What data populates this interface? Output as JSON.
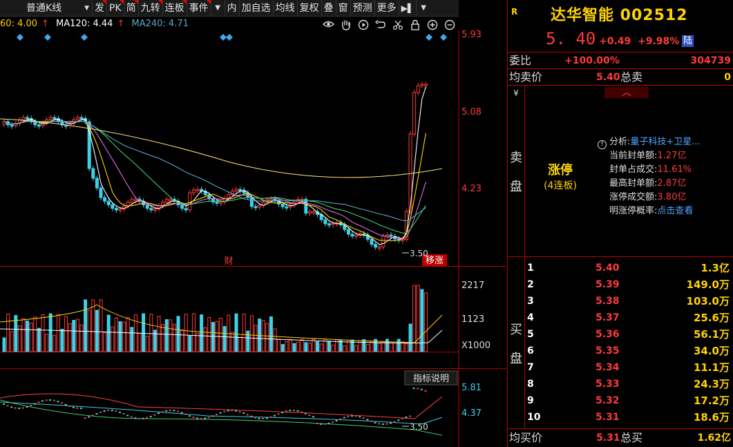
{
  "toolbar": {
    "kline_label": "普通K线",
    "buttons": [
      "发",
      "PK",
      "简",
      "九转",
      "连板",
      "事件",
      "内",
      "加自选",
      "均线",
      "复权",
      "叠",
      "窗",
      "预测",
      "更多"
    ],
    "arrow": "▶▌"
  },
  "ma_legend": {
    "ma60": "60: 4.00",
    "ma60_arrow": "↑",
    "ma120": "MA120: 4.44",
    "ma120_arrow": "↑",
    "ma240": "MA240: 4.71",
    "colors": {
      "ma60": "#ffd400",
      "ma120": "#ffffff",
      "ma240": "#5aa7c8"
    }
  },
  "chart_tools": [
    "eye-icon",
    "hand-icon",
    "play-icon",
    "undo-icon",
    "scissors-icon",
    "lock-icon",
    "zoom-in-icon",
    "zoom-out-icon"
  ],
  "price_axis": {
    "labels": [
      "5.93",
      "5.08",
      "4.23"
    ],
    "low_label": "3.50"
  },
  "markers": {
    "fin": "财",
    "zt": "移涨"
  },
  "volume_axis": {
    "labels": [
      "2217",
      "1123",
      "X1000"
    ]
  },
  "indicator": {
    "button": "指标说明",
    "labels": [
      "5.81",
      "4.37",
      "3.50"
    ]
  },
  "quote": {
    "tag": "R",
    "name": "达华智能 002512",
    "price": "5. 40",
    "change": "+0.49",
    "pct": "+9.98%",
    "board": "陆",
    "webi_label": "委比",
    "webi_value": "+100.00%",
    "webi_cha": "304739",
    "avg_sell_label": "均卖价",
    "avg_sell_value": "5.40",
    "total_sell_label": "总卖",
    "total_sell_value": "0",
    "sell_side_label": "卖",
    "sell_side_label2": "盘",
    "yen": "¥",
    "zt_big": "涨停",
    "zt_small": "(4连板)",
    "analysis_key": "分析:",
    "analysis_value": "量子科技+卫星...",
    "info": [
      {
        "k": "当前封单额:",
        "v": "1.27亿"
      },
      {
        "k": "封单占成交:",
        "v": "11.61%"
      },
      {
        "k": "最高封单额:",
        "v": "2.87亿"
      },
      {
        "k": "涨停成交额:",
        "v": "3.80亿"
      }
    ],
    "prob_key": "明涨停概率:",
    "prob_link": "点击查看",
    "buy_side_label": "买",
    "buy_side_label2": "盘",
    "bids": [
      {
        "lvl": "1",
        "price": "5.40",
        "vol": "1.3亿"
      },
      {
        "lvl": "2",
        "price": "5.39",
        "vol": "149.0万"
      },
      {
        "lvl": "3",
        "price": "5.38",
        "vol": "103.0万"
      },
      {
        "lvl": "4",
        "price": "5.37",
        "vol": "25.6万"
      },
      {
        "lvl": "5",
        "price": "5.36",
        "vol": "56.1万"
      },
      {
        "lvl": "6",
        "price": "5.35",
        "vol": "34.0万"
      },
      {
        "lvl": "7",
        "price": "5.34",
        "vol": "11.1万"
      },
      {
        "lvl": "8",
        "price": "5.33",
        "vol": "24.3万"
      },
      {
        "lvl": "9",
        "price": "5.32",
        "vol": "17.2万"
      },
      {
        "lvl": "10",
        "price": "5.31",
        "vol": "18.6万"
      }
    ],
    "avg_buy_label": "均买价",
    "avg_buy_value": "5.31",
    "total_buy_label": "总买",
    "total_buy_value": "1.62亿"
  },
  "colors": {
    "up": "#ff3b3b",
    "down": "#3fd0e8",
    "accent": "#ffd400",
    "border": "#b00000"
  }
}
